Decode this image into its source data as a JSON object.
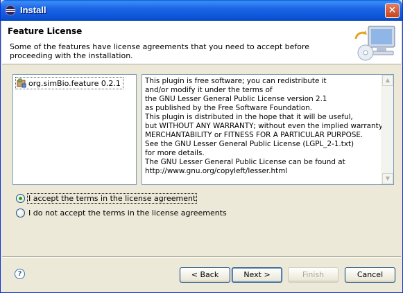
{
  "window": {
    "title": "Install",
    "close_glyph": "✕"
  },
  "header": {
    "title": "Feature License",
    "description": "Some of the features have license agreements that you need to accept before proceeding with the installation."
  },
  "features": {
    "items": [
      {
        "label": "org.simBio.feature 0.2.1",
        "icon": "plugin-icon"
      }
    ]
  },
  "license": {
    "text": "This plugin is free software; you can redistribute it\nand/or modify it under the terms of\nthe GNU Lesser General Public License version 2.1\nas published by the Free Software Foundation.\nThis plugin is distributed in the hope that it will be useful,\nbut WITHOUT ANY WARRANTY; without even the implied warranty of\nMERCHANTABILITY or FITNESS FOR A PARTICULAR PURPOSE.\nSee the GNU Lesser General Public License (LGPL_2-1.txt)\nfor more details.\nThe GNU Lesser General Public License can be found at\nhttp://www.gnu.org/copyleft/lesser.html"
  },
  "options": {
    "accept_label": "I accept the terms in the license agreement",
    "decline_label": "I do not accept the terms in the license agreements",
    "selected": "accept"
  },
  "buttons": {
    "help_glyph": "?",
    "back": "< Back",
    "next": "Next >",
    "finish": "Finish",
    "cancel": "Cancel"
  },
  "colors": {
    "titlebar": "#0b52d6",
    "dialog_bg": "#ece9d8",
    "radio_checked": "#21a121"
  }
}
